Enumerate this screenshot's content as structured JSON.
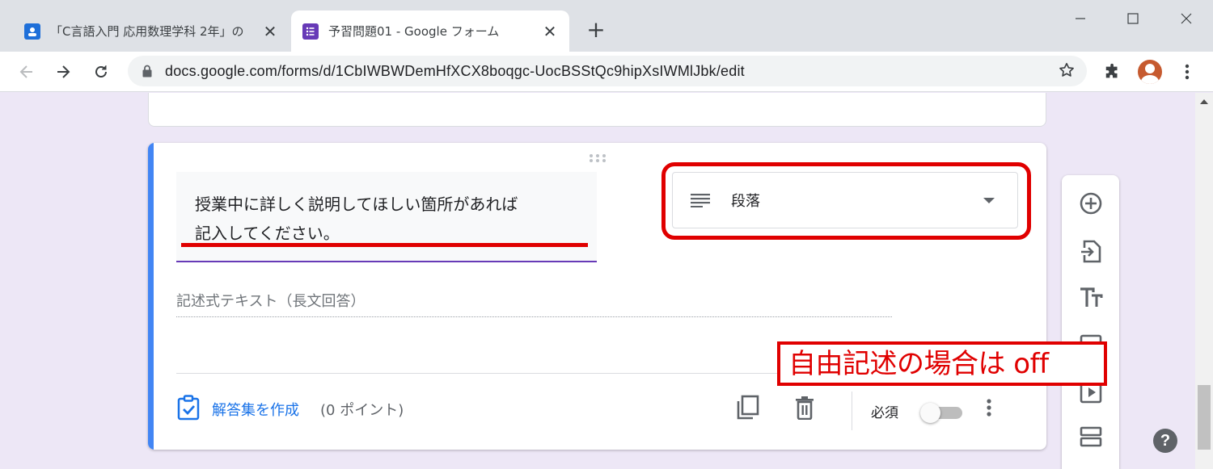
{
  "browser": {
    "tabs": [
      {
        "title": "「C言語入門 応用数理学科 2年」の",
        "favicon": "google-classroom-icon",
        "favicon_color": "#1e6fd9",
        "active": false
      },
      {
        "title": "予習問題01 - Google フォーム",
        "favicon": "google-forms-icon",
        "favicon_color": "#673ab7",
        "active": true
      }
    ],
    "new_tab": "+",
    "url": "docs.google.com/forms/d/1CbIWBWDemHfXCX8boqgc-UocBSStQc9hipXsIWMlJbk/edit"
  },
  "question": {
    "title_line1": "授業中に詳しく説明してほしい箇所があれば",
    "title_line2": "記入してください。",
    "type": "段落",
    "answer_placeholder": "記述式テキスト（長文回答）",
    "answer_key_label": "解答集を作成",
    "points": "(0 ポイント)",
    "required_label": "必須",
    "required": false
  },
  "annotation": {
    "text": "自由記述の場合は off",
    "color": "#e00000"
  },
  "help": "?",
  "colors": {
    "accent": "#4285f4",
    "form_theme": "#673ab7",
    "background": "#ede7f6",
    "link": "#1a73e8"
  }
}
